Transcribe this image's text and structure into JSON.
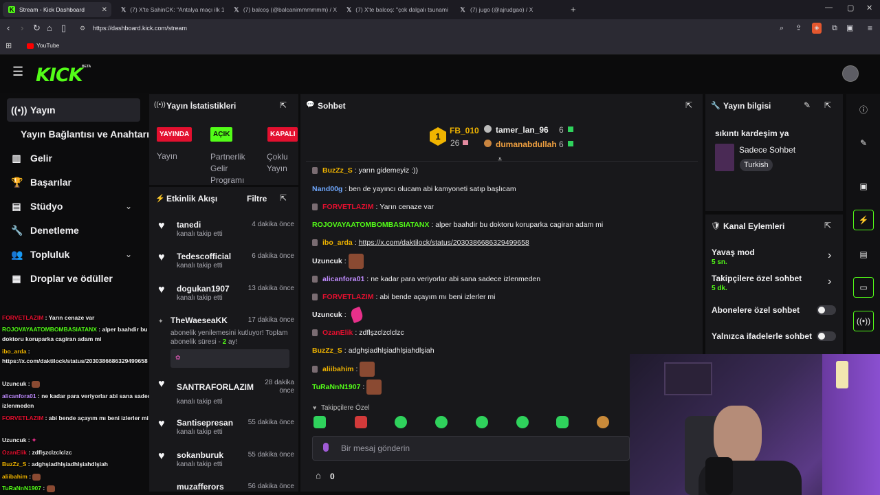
{
  "browser": {
    "tabs": [
      {
        "icon": "kick-favicon",
        "label": "Stream - Kick Dashboard",
        "active": true
      },
      {
        "icon": "x-favicon",
        "label": "(7) X'te SahinCK: \"Antalya maçı ilk 11"
      },
      {
        "icon": "x-favicon",
        "label": "(7) balcoş (@balcanimmmmmm) / X"
      },
      {
        "icon": "x-favicon",
        "label": "(7) X'te balcoş: \"çok dalgalı tsunami o"
      },
      {
        "icon": "x-favicon",
        "label": "(7) jugo (@ajrudgao) / X"
      }
    ],
    "url": "https://dashboard.kick.com/stream",
    "bookmark": "YouTube"
  },
  "kick": {
    "logo": "KICK",
    "beta": "BETA"
  },
  "sidebar": {
    "items": [
      {
        "icon": "broadcast-icon",
        "label": "Yayın",
        "active": true
      },
      {
        "icon": "",
        "label": "Yayın Bağlantısı ve Anahtarı"
      },
      {
        "icon": "chart-icon",
        "label": "Gelir"
      },
      {
        "icon": "trophy-icon",
        "label": "Başarılar"
      },
      {
        "icon": "studio-icon",
        "label": "Stüdyo",
        "chevron": true
      },
      {
        "icon": "wrench-icon",
        "label": "Denetleme"
      },
      {
        "icon": "community-icon",
        "label": "Topluluk",
        "chevron": true
      },
      {
        "icon": "drops-icon",
        "label": "Droplar ve ödüller"
      }
    ]
  },
  "stats": {
    "title": "Yayın İstatistikleri",
    "badges": [
      {
        "label": "YAYINDA",
        "color": "#e3102f",
        "caption": "Yayın"
      },
      {
        "label": "AÇIK",
        "color": "#53fc18",
        "caption": "Partnerlik Gelir Programı"
      },
      {
        "label": "KAPALI",
        "color": "#e3102f",
        "caption": "Çoklu Yayın"
      }
    ]
  },
  "activity": {
    "title": "Etkinlik Akışı",
    "filter": "Filtre",
    "items": [
      {
        "name": "tanedi",
        "sub": "kanalı takip etti",
        "time": "4 dakika önce"
      },
      {
        "name": "Tedescofficial",
        "sub": "kanalı takip etti",
        "time": "6 dakika önce"
      },
      {
        "name": "dogukan1907",
        "sub": "kanalı takip etti",
        "time": "13 dakika önce"
      },
      {
        "name": "TheWaeseaKK",
        "sub": "abonelik yenilemesini kutluyor! Toplam abonelik süresi -",
        "months": "2",
        "months_suffix": "ay!",
        "time": "17 dakika önce"
      },
      {
        "name": "SANTRAFORLAZIM",
        "sub": "kanalı takip etti",
        "time": "28 dakika önce"
      },
      {
        "name": "Santisepresan",
        "sub": "kanalı takip etti",
        "time": "55 dakika önce"
      },
      {
        "name": "sokanburuk",
        "sub": "kanalı takip etti",
        "time": "55 dakika önce"
      },
      {
        "name": "muzafferors",
        "sub": "",
        "time": "56 dakika önce"
      }
    ]
  },
  "chat": {
    "title": "Sohbet",
    "leaderboard": {
      "rank": "1",
      "first": {
        "name": "FB_010",
        "score": "26"
      },
      "second": {
        "name": "tamer_lan_96",
        "score": "6"
      },
      "third": {
        "name": "dumanabdullah",
        "score": "6"
      }
    },
    "messages": [
      {
        "user": "BuzZz_S",
        "color": "#f0b400",
        "text": "yarın gidemeyiz :))",
        "badge": true
      },
      {
        "user": "Nand00g",
        "color": "#6fa8ff",
        "text": "ben de yayıncı olucam abi kamyoneti satıp başlıcam",
        "badge": false
      },
      {
        "user": "FORVETLAZIM",
        "color": "#e3102f",
        "text": "Yarın cenaze var",
        "badge": true
      },
      {
        "user": "ROJOVAYAATOMBOMBASIATANX",
        "color": "#53fc18",
        "text": "alper baahdir bu doktoru koruparka cagiran adam mi",
        "badge": false
      },
      {
        "user": "ibo_arda",
        "color": "#f0b400",
        "text": "https://x.com/daktilock/status/2030386686329499658",
        "badge": true,
        "link": true
      },
      {
        "user": "Uzuncuk",
        "color": "#efeff1",
        "text": "",
        "badge": false,
        "emote": "brown"
      },
      {
        "user": "alicanfora01",
        "color": "#c08cff",
        "text": "ne kadar para veriyorlar abi sana sadece izlenmeden",
        "badge": true
      },
      {
        "user": "FORVETLAZIM",
        "color": "#e3102f",
        "text": "abi bende açayım mı beni izlerler mi",
        "badge": true
      },
      {
        "user": "Uzuncuk",
        "color": "#efeff1",
        "text": "",
        "badge": false,
        "emote": "pink"
      },
      {
        "user": "OzanElik",
        "color": "#e3102f",
        "text": "zdflşzclzclclzc",
        "badge": true
      },
      {
        "user": "BuzZz_S",
        "color": "#f0b400",
        "text": "adghşiadhlşiadhlşiahdlşiah",
        "badge": false
      },
      {
        "user": "aliibahim",
        "color": "#f0b400",
        "text": "",
        "badge": true,
        "emote": "brown"
      },
      {
        "user": "TuRaNnN1907",
        "color": "#53fc18",
        "text": "",
        "badge": false,
        "emote": "brown"
      }
    ],
    "followers_only": "Takipçilere Özel",
    "input_placeholder": "Bir mesaj gönderin",
    "points": "0"
  },
  "stream_info": {
    "title": "Yayın bilgisi",
    "stream_title": "sıkıntı kardeşim ya",
    "category": "Sadece Sohbet",
    "language": "Turkish"
  },
  "channel_actions": {
    "title": "Kanal Eylemleri",
    "slow_mode": "Yavaş mod",
    "slow_value": "5 sn.",
    "followers_chat": "Takipçilere özel sohbet",
    "followers_value": "5 dk.",
    "subs_chat": "Abonelere özel sohbet",
    "emotes_chat": "Yalnızca ifadelerle sohbet"
  },
  "overlay_chat": [
    {
      "user": "FORVETLAZIM",
      "color": "#e3102f",
      "text": "Yarın cenaze var"
    },
    {
      "user": "ROJOVAYAATOMBOMBASIATANX",
      "color": "#53fc18",
      "text": "alper baahdir bu doktoru koruparka cagiran adam mi"
    },
    {
      "user": "ibo_arda",
      "color": "#f0b400",
      "text": "https://x.com/daktilock/status/2030386686329499658"
    },
    {
      "user": "Uzuncuk",
      "color": "#ffffff",
      "text": ""
    },
    {
      "user": "alicanfora01",
      "color": "#c08cff",
      "text": "ne kadar para veriyorlar abi sana sadece izlenmeden"
    },
    {
      "user": "FORVETLAZIM",
      "color": "#e3102f",
      "text": "abi bende açayım mı beni izlerler mi"
    },
    {
      "user": "Uzuncuk",
      "color": "#ffffff",
      "text": ""
    },
    {
      "user": "OzanElik",
      "color": "#e3102f",
      "text": "zdflşzclzclclzc"
    },
    {
      "user": "BuzZz_S",
      "color": "#f0b400",
      "text": "adghşiadhlşiadhlşiahdlşiah"
    },
    {
      "user": "aliibahim",
      "color": "#f0b400",
      "text": ""
    },
    {
      "user": "TuRaNnN1907",
      "color": "#53fc18",
      "text": ""
    }
  ],
  "colors": {
    "accent": "#53fc18",
    "live": "#e3102f",
    "panel": "#18181b"
  }
}
